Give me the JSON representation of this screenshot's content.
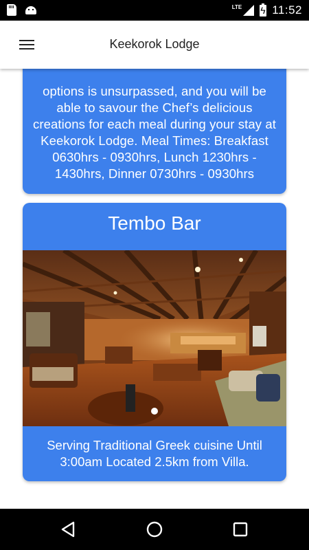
{
  "status_bar": {
    "time": "11:52",
    "network": "LTE",
    "icons": [
      "sd-card-icon",
      "android-icon",
      "signal-icon",
      "battery-charging-icon"
    ]
  },
  "app_bar": {
    "title": "Keekorok Lodge",
    "menu_icon": "hamburger-menu-icon"
  },
  "cards": {
    "previous": {
      "text": "options is unsurpassed, and you will be able to savour the Chef’s delicious creations for each meal during your stay at Keekorok Lodge. Meal Times: Breakfast 0630hrs - 0930hrs, Lunch 1230hrs - 1430hrs, Dinner 0730hrs - 0930hrs"
    },
    "tembo_bar": {
      "title": "Tembo Bar",
      "description": "Serving Traditional Greek cuisine Until 3:00am Located 2.5km from Villa.",
      "carousel": {
        "total": 1,
        "active": 1
      }
    }
  },
  "colors": {
    "card": "#3d80ec",
    "status_bar": "#000000",
    "nav_bar": "#000000",
    "app_bar": "#ffffff"
  },
  "nav_bar": {
    "icons": [
      "back-icon",
      "home-icon",
      "recent-apps-icon"
    ]
  }
}
